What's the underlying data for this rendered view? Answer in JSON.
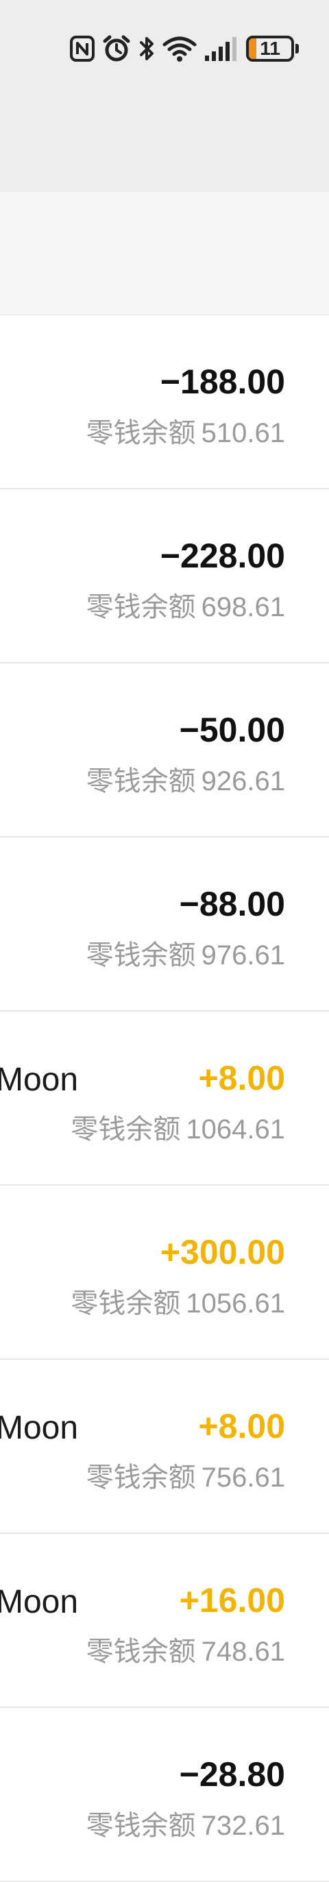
{
  "status_bar": {
    "battery_level": "11",
    "icons": [
      "nfc-icon",
      "alarm-icon",
      "bluetooth-icon",
      "wifi-icon",
      "signal-icon",
      "battery-icon"
    ]
  },
  "colors": {
    "income": "#f2b400",
    "expense": "#111111",
    "balance_text": "#9a9a9a",
    "header_bg": "#ededed"
  },
  "transactions": [
    {
      "name": "",
      "amount": "−188.00",
      "type": "out",
      "balance_label": "零钱余额",
      "balance": "510.61"
    },
    {
      "name": "",
      "amount": "−228.00",
      "type": "out",
      "balance_label": "零钱余额",
      "balance": "698.61"
    },
    {
      "name": "",
      "amount": "−50.00",
      "type": "out",
      "balance_label": "零钱余额",
      "balance": "926.61"
    },
    {
      "name": "",
      "amount": "−88.00",
      "type": "out",
      "balance_label": "零钱余额",
      "balance": "976.61"
    },
    {
      "name": "Moon",
      "amount": "+8.00",
      "type": "in",
      "balance_label": "零钱余额",
      "balance": "1064.61"
    },
    {
      "name": "",
      "amount": "+300.00",
      "type": "in",
      "balance_label": "零钱余额",
      "balance": "1056.61"
    },
    {
      "name": "Moon",
      "amount": "+8.00",
      "type": "in",
      "balance_label": "零钱余额",
      "balance": "756.61"
    },
    {
      "name": "Moon",
      "amount": "+16.00",
      "type": "in",
      "balance_label": "零钱余额",
      "balance": "748.61"
    },
    {
      "name": "",
      "amount": "−28.80",
      "type": "out",
      "balance_label": "零钱余额",
      "balance": "732.61"
    }
  ]
}
